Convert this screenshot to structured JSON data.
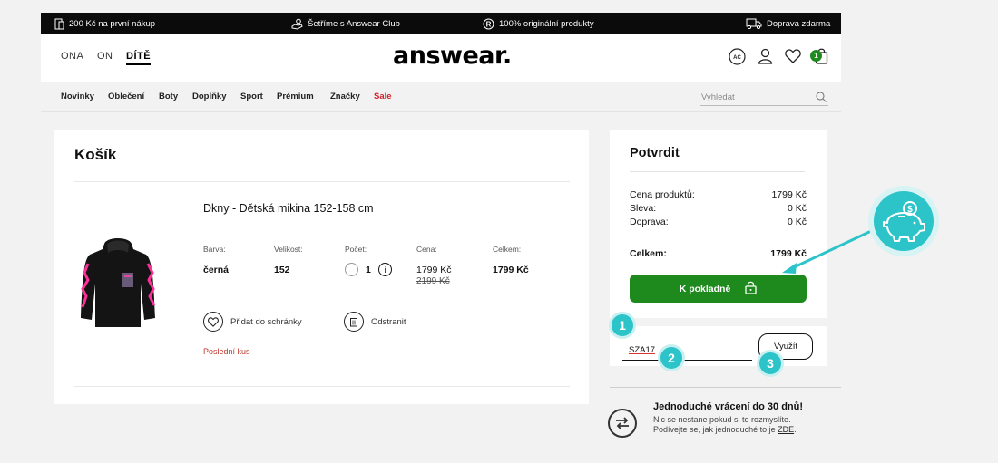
{
  "promos": [
    {
      "icon": "receipt-icon",
      "text": "200 Kč na první nákup"
    },
    {
      "icon": "hand-coins-icon",
      "text": "Šetříme s Answear Club"
    },
    {
      "icon": "registered-icon",
      "text": "100% originální produkty"
    },
    {
      "icon": "truck-icon",
      "text": "Doprava zdarma"
    }
  ],
  "header": {
    "genders": [
      "ONA",
      "ON",
      "DÍTĚ"
    ],
    "active_gender": "DÍTĚ",
    "logo": "answear.",
    "club_icon_text": "AC",
    "cart_count": "1"
  },
  "nav": {
    "items": [
      "Novinky",
      "Oblečení",
      "Boty",
      "Doplňky",
      "Sport",
      "Prémium",
      "Značky",
      "Sale"
    ],
    "search_placeholder": "Vyhledat"
  },
  "cart": {
    "title": "Košík",
    "product": {
      "name": "Dkny - Dětská mikina 152-158 cm",
      "labels": {
        "color": "Barva:",
        "size": "Velikost:",
        "qty": "Počet:",
        "price": "Cena:",
        "total": "Celkem:"
      },
      "color": "černá",
      "size": "152",
      "qty": "1",
      "price": "1799 Kč",
      "old_price": "2199 Kč",
      "total": "1799 Kč",
      "add_to_wishlist": "Přidat do schránky",
      "remove": "Odstranit",
      "stock_note": "Poslední kus"
    }
  },
  "summary": {
    "title": "Potvrdit",
    "rows": [
      {
        "label": "Cena produktů:",
        "value": "1799 Kč"
      },
      {
        "label": "Sleva:",
        "value": "0 Kč"
      },
      {
        "label": "Doprava:",
        "value": "0 Kč"
      }
    ],
    "total_label": "Celkem:",
    "total_value": "1799 Kč",
    "checkout_label": "K pokladně"
  },
  "coupon": {
    "value": "SZA17",
    "apply_label": "Využít"
  },
  "returns": {
    "title": "Jednoduché vrácení do 30 dnů!",
    "line1": "Nic se nestane pokud si to rozmyslíte.",
    "line2": "Podívejte se, jak jednoduché to je",
    "link": "ZDE",
    "end": "."
  },
  "annotations": {
    "steps": [
      "1",
      "2",
      "3"
    ],
    "accent": "#2cc3c9"
  },
  "colors": {
    "checkout_green": "#1e8a1e",
    "sale_red": "#d3212d",
    "stock_red": "#c0392b"
  }
}
